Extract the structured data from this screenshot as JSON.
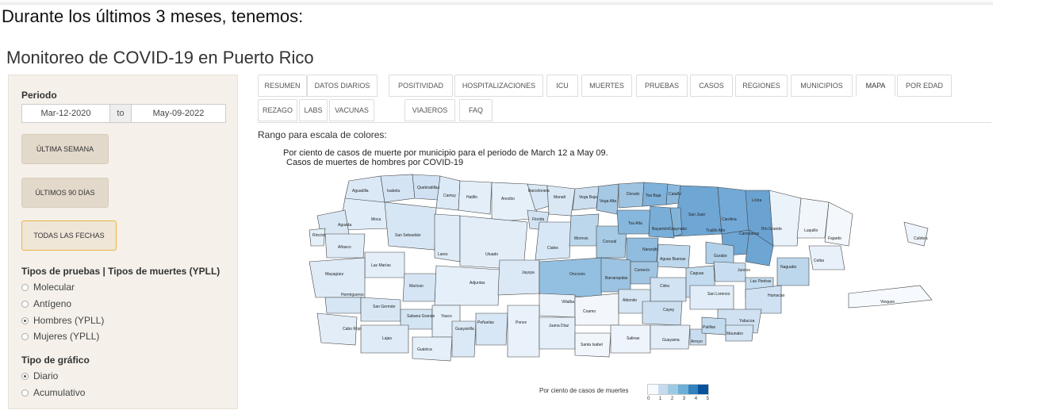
{
  "intro": "Durante los últimos 3 meses, tenemos:",
  "app_title": "Monitoreo de COVID-19 en Puerto Rico",
  "sidebar": {
    "period_label": "Periodo",
    "start_date": "Mar-12-2020",
    "to_label": "to",
    "end_date": "May-09-2022",
    "buttons": [
      "ÚLTIMA SEMANA",
      "ÚLTIMOS 90 DÍAS",
      "TODAS LAS FECHAS"
    ],
    "tests_label": "Tipos de pruebas | Tipos de muertes (YPLL)",
    "test_options": [
      {
        "label": "Molecular",
        "selected": false
      },
      {
        "label": "Antígeno",
        "selected": false
      },
      {
        "label": "Hombres (YPLL)",
        "selected": true
      },
      {
        "label": "Mujeres (YPLL)",
        "selected": false
      }
    ],
    "chart_type_label": "Tipo de gráfico",
    "chart_type_options": [
      {
        "label": "Diario",
        "selected": true
      },
      {
        "label": "Acumulativo",
        "selected": false
      }
    ]
  },
  "tabs": {
    "row1": [
      "RESUMEN",
      "DATOS DIARIOS",
      "POSITIVIDAD",
      "HOSPITALIZACIONES",
      "ICU",
      "MUERTES",
      "PRUEBAS",
      "CASOS",
      "REGIONES",
      "MUNICIPIOS",
      "MAPA",
      "POR EDAD"
    ],
    "row2": [
      "REZAGO",
      "LABS",
      "VACUNAS",
      "VIAJEROS",
      "FAQ"
    ],
    "active": "MAPA"
  },
  "main": {
    "range_label": "Rango para escala de colores:",
    "map_title_1": "Por ciento de casos de muerte por municipio para el periodo de March 12 a May 09.",
    "map_title_2": "Casos de muertes de hombres por COVID-19",
    "legend_label": "Por ciento de casos de muertes",
    "legend_ticks": [
      "0",
      "1",
      "2",
      "3",
      "4",
      "5"
    ],
    "legend_colors": [
      "#f7fbff",
      "#c6dbef",
      "#9ecae1",
      "#6baed6",
      "#3182bd",
      "#08519c"
    ]
  },
  "municipios": [
    "Aguadilla",
    "Isabela",
    "Quebradillas",
    "Camuy",
    "Hatillo",
    "Arecibo",
    "Barceloneta",
    "Manatí",
    "Vega Baja",
    "Dorado",
    "Toa Baja",
    "Cataño",
    "Loíza",
    "Vega Alta",
    "San Juan",
    "Carolina",
    "Río Grande",
    "Luquillo",
    "Fajardo",
    "Culebra",
    "Moca",
    "Aguada",
    "Rincón",
    "Añasco",
    "San Sebastián",
    "Lares",
    "Utuado",
    "Florida",
    "Ciales",
    "Morovis",
    "Corozal",
    "Toa Alta",
    "Bayamón",
    "Guaynabo",
    "Trujillo Alto",
    "Canóvanas",
    "Naranjito",
    "Aguas Buenas",
    "Gurabo",
    "Ceiba",
    "Las Marías",
    "Mayagüez",
    "Maricao",
    "Adjuntas",
    "Jayuya",
    "Orocovis",
    "Barranquitas",
    "Comerío",
    "Cidra",
    "Caguas",
    "Juncos",
    "Naguabo",
    "Las Piedras",
    "Hormigueros",
    "San Germán",
    "Sabana Grande",
    "Yauco",
    "Villalba",
    "Coamo",
    "Aibonito",
    "San Lorenzo",
    "Humacao",
    "Cayey",
    "Yabucoa",
    "Cabo Rojo",
    "Lajas",
    "Guánica",
    "Guayanilla",
    "Peñuelas",
    "Ponce",
    "Juana Díaz",
    "Santa Isabel",
    "Salinas",
    "Guayama",
    "Arroyo",
    "Patillas",
    "Maunabo",
    "Vieques"
  ]
}
